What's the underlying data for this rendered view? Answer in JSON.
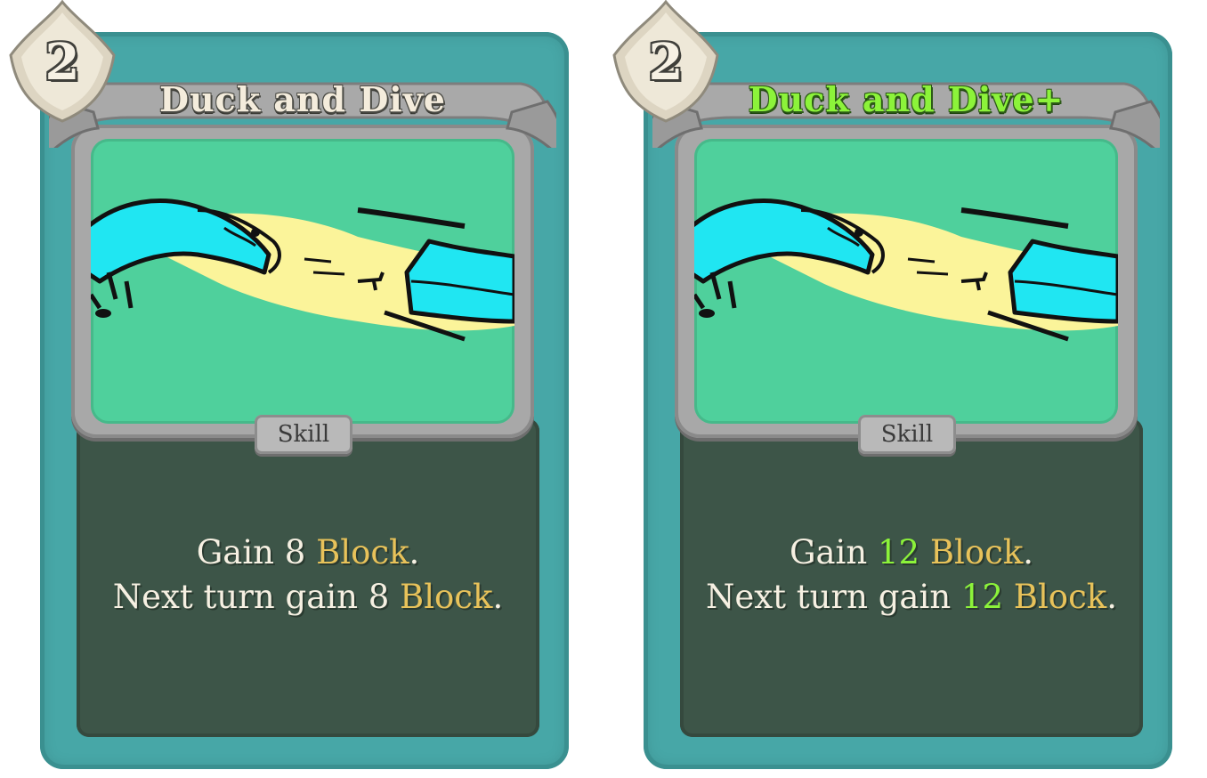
{
  "cards": [
    {
      "energy_cost": "2",
      "title": "Duck and Dive",
      "type": "Skill",
      "desc_line1": {
        "prefix": "Gain ",
        "number": "8",
        "keyword": "Block",
        "suffix": "."
      },
      "desc_line2": {
        "prefix": "Next turn gain ",
        "number": "8",
        "keyword": "Block",
        "suffix": "."
      }
    },
    {
      "energy_cost": "2",
      "title": "Duck and Dive+",
      "type": "Skill",
      "desc_line1": {
        "prefix": "Gain ",
        "number": "12",
        "keyword": "Block",
        "suffix": "."
      },
      "desc_line2": {
        "prefix": "Next turn gain ",
        "number": "12",
        "keyword": "Block",
        "suffix": "."
      }
    }
  ],
  "colors": {
    "frame_teal": "#47a7a7",
    "body_dark_green": "#3d5548",
    "art_background": "#4fd09c",
    "keyword_gold": "#e8c25a",
    "upgrade_green": "#8cf33a"
  }
}
